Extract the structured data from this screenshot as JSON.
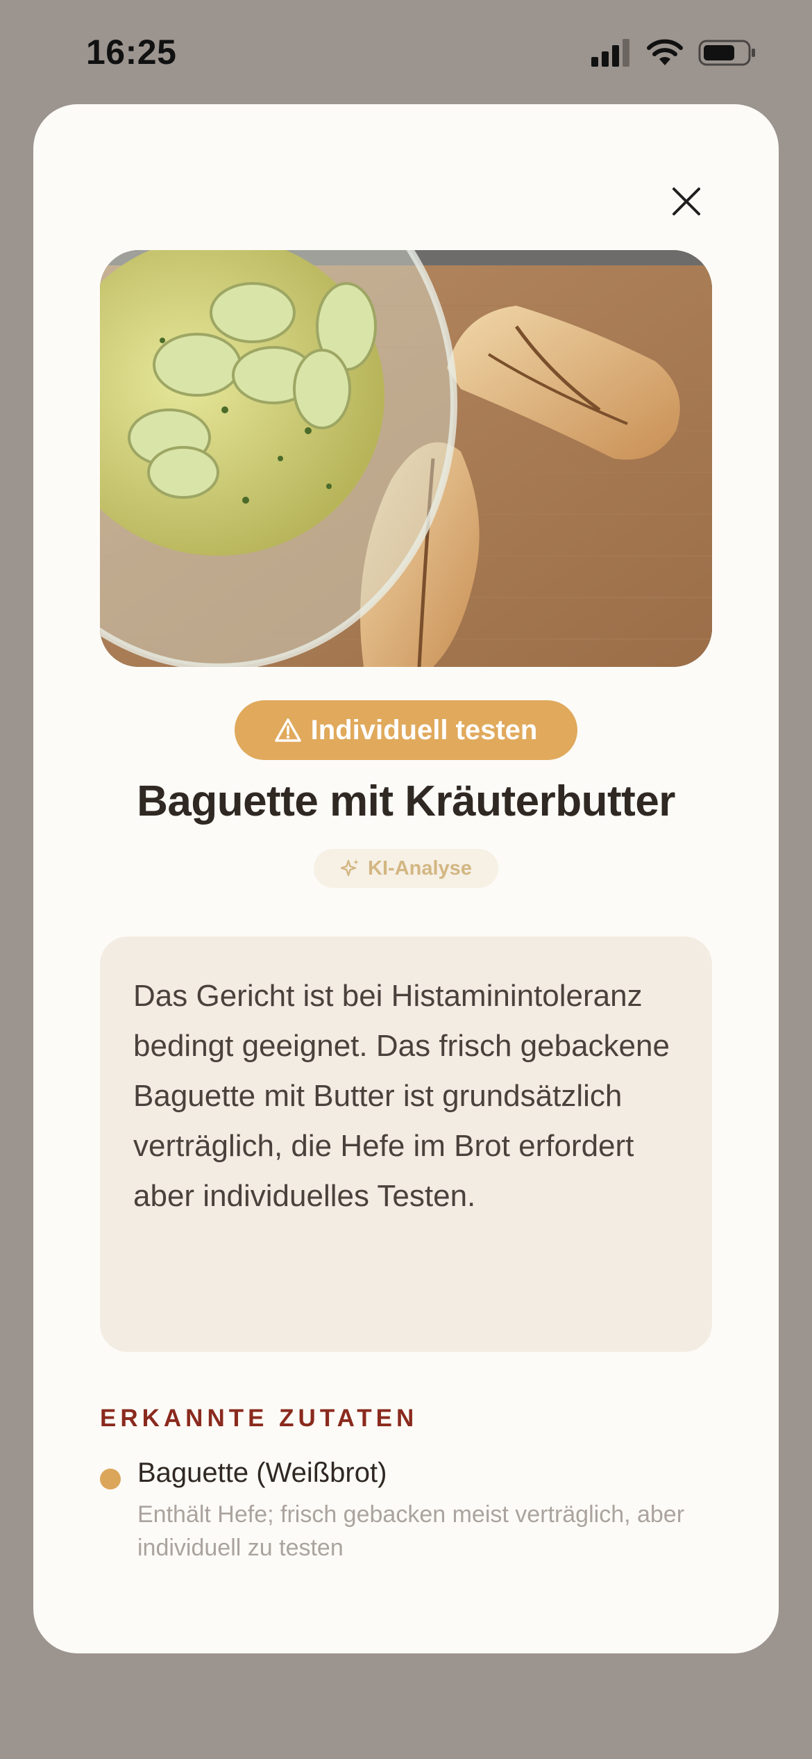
{
  "status_bar": {
    "time": "16:25",
    "icons": [
      "cellular-signal-icon",
      "wifi-icon",
      "battery-icon"
    ]
  },
  "sheet": {
    "close_icon": "close-icon",
    "photo_alt": "Baguette mit Kräuterbutter",
    "badge": {
      "icon": "warning-triangle-icon",
      "label": "Individuell testen",
      "color": "#e0a95c"
    },
    "title": "Baguette mit Kräuterbutter",
    "ki_chip": {
      "icon": "sparkle-icon",
      "label": "KI-Analyse"
    },
    "summary": "Das Gericht ist bei Histaminintoleranz bedingt geeignet. Das frisch gebackene Baguette mit Butter ist grundsätzlich verträglich, die Hefe im Brot erfordert aber individuelles Testen.",
    "ingredients_heading": "ERKANNTE ZUTATEN",
    "ingredients": [
      {
        "name": "Baguette (Weißbrot)",
        "description": "Enthält Hefe; frisch gebacken meist verträglich, aber individuell zu testen",
        "status_color": "#dba65a"
      }
    ]
  }
}
